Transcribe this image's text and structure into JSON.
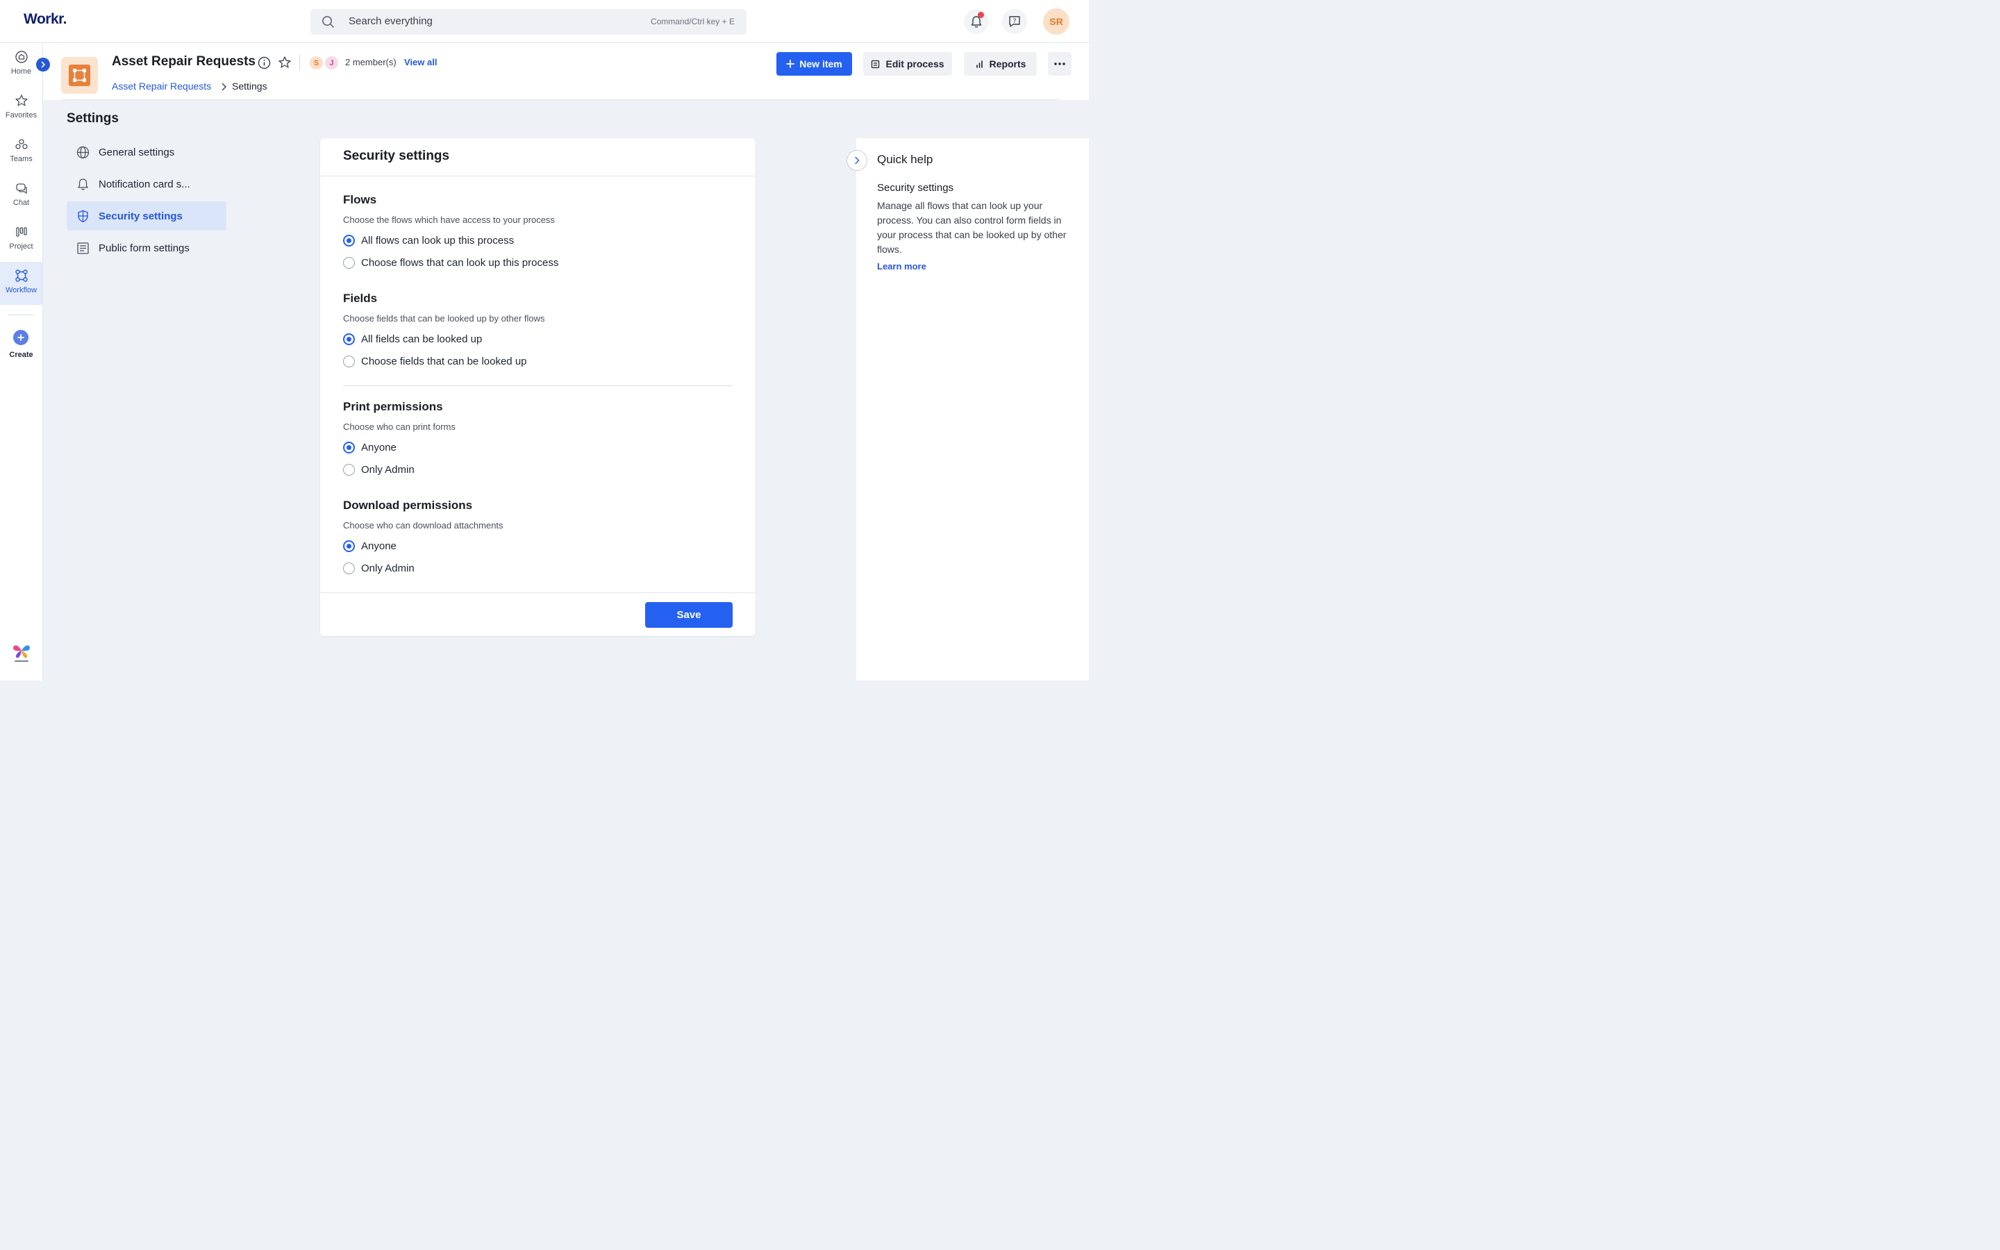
{
  "app": {
    "logo": "Workr."
  },
  "search": {
    "placeholder": "Search everything",
    "shortcut": "Command/Ctrl key + E"
  },
  "user": {
    "initials": "SR"
  },
  "rail": {
    "items": [
      {
        "label": "Home",
        "icon": "home-icon"
      },
      {
        "label": "Favorites",
        "icon": "star-icon"
      },
      {
        "label": "Teams",
        "icon": "teams-icon"
      },
      {
        "label": "Chat",
        "icon": "chat-icon"
      },
      {
        "label": "Project",
        "icon": "project-icon"
      },
      {
        "label": "Workflow",
        "icon": "workflow-icon",
        "active": true
      }
    ],
    "create_label": "Create"
  },
  "process": {
    "title": "Asset Repair Requests",
    "members": [
      "S",
      "J"
    ],
    "member_count": "2 member(s)",
    "view_all": "View all"
  },
  "breadcrumb": {
    "link": "Asset Repair Requests",
    "current": "Settings"
  },
  "actions": {
    "new_item": "New item",
    "edit_process": "Edit process",
    "reports": "Reports"
  },
  "settings": {
    "title": "Settings",
    "nav": [
      {
        "label": "General settings",
        "icon": "globe-icon"
      },
      {
        "label": "Notification card s...",
        "icon": "bell-icon"
      },
      {
        "label": "Security settings",
        "icon": "shield-icon",
        "active": true
      },
      {
        "label": "Public form settings",
        "icon": "form-icon"
      }
    ]
  },
  "card": {
    "title": "Security settings",
    "sections": [
      {
        "title": "Flows",
        "desc": "Choose the flows which have access to your process",
        "options": [
          "All flows can look up this process",
          "Choose flows that can look up this process"
        ],
        "selected": 0
      },
      {
        "title": "Fields",
        "desc": "Choose fields that can be looked up by other flows",
        "options": [
          "All fields can be looked up",
          "Choose fields that can be looked up"
        ],
        "selected": 0
      },
      {
        "title": "Print permissions",
        "desc": "Choose who can print forms",
        "options": [
          "Anyone",
          "Only Admin"
        ],
        "selected": 0
      },
      {
        "title": "Download permissions",
        "desc": "Choose who can download attachments",
        "options": [
          "Anyone",
          "Only Admin"
        ],
        "selected": 0
      }
    ],
    "save": "Save"
  },
  "quick_help": {
    "title": "Quick help",
    "subtitle": "Security settings",
    "body": "Manage all flows that can look up your process. You can also control form fields in your process that can be looked up by other flows.",
    "link": "Learn more"
  },
  "colors": {
    "accent": "#2461f0",
    "brand": "#0f1f6b",
    "process_icon": "#e8813a"
  }
}
